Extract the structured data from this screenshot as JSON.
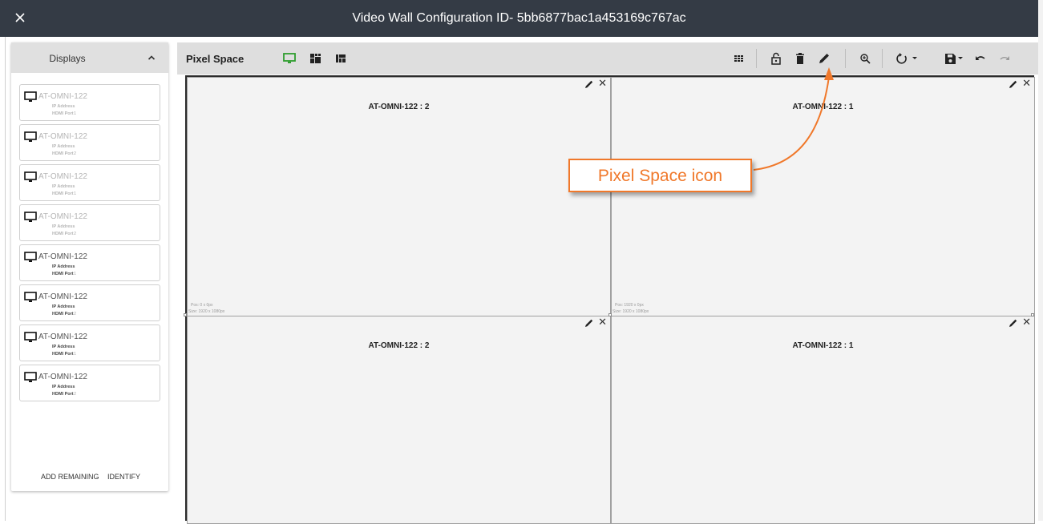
{
  "header": {
    "title": "Video Wall Configuration ID- 5bb6877bac1a453169c767ac",
    "close_icon": "close-icon"
  },
  "sidebar": {
    "title": "Displays",
    "collapse_icon": "chevron-up-icon",
    "ip_label": "IP Address",
    "port_label": "HDMI Port",
    "items": [
      {
        "name": "AT-OMNI-122",
        "port": "1",
        "state": "dim"
      },
      {
        "name": "AT-OMNI-122",
        "port": "2",
        "state": "dim"
      },
      {
        "name": "AT-OMNI-122",
        "port": "1",
        "state": "dim"
      },
      {
        "name": "AT-OMNI-122",
        "port": "2",
        "state": "dim"
      },
      {
        "name": "AT-OMNI-122",
        "port": "1",
        "state": "active"
      },
      {
        "name": "AT-OMNI-122",
        "port": "2",
        "state": "active"
      },
      {
        "name": "AT-OMNI-122",
        "port": "1",
        "state": "active"
      },
      {
        "name": "AT-OMNI-122",
        "port": "2",
        "state": "active"
      }
    ],
    "actions": {
      "add_remaining": "ADD REMAINING",
      "identify": "IDENTIFY"
    }
  },
  "toolbar": {
    "title": "Pixel Space",
    "icons": [
      "monitor-icon",
      "quilt-icon",
      "dashboard-icon",
      "grid-icon",
      "lock-open-icon",
      "trash-icon",
      "pencil-icon",
      "zoom-in-icon",
      "rotate-icon",
      "save-icon",
      "undo-icon",
      "redo-icon"
    ]
  },
  "canvas": {
    "cells": [
      {
        "label": "AT-OMNI-122 : 2",
        "pos": "Pos: 0 x 0px",
        "size": "Size: 1920 x 1080px"
      },
      {
        "label": "AT-OMNI-122 : 1",
        "pos": "Pos: 1920 x 0px",
        "size": "Size: 1920 x 1080px"
      },
      {
        "label": "AT-OMNI-122 : 2",
        "pos": "",
        "size": ""
      },
      {
        "label": "AT-OMNI-122 : 1",
        "pos": "",
        "size": ""
      }
    ]
  },
  "callout": {
    "text": "Pixel Space icon"
  },
  "colors": {
    "header_bg": "#343b45",
    "accent_green": "#2e9e2e",
    "callout_orange": "#f0782a",
    "toolbar_bg": "#dedede"
  }
}
